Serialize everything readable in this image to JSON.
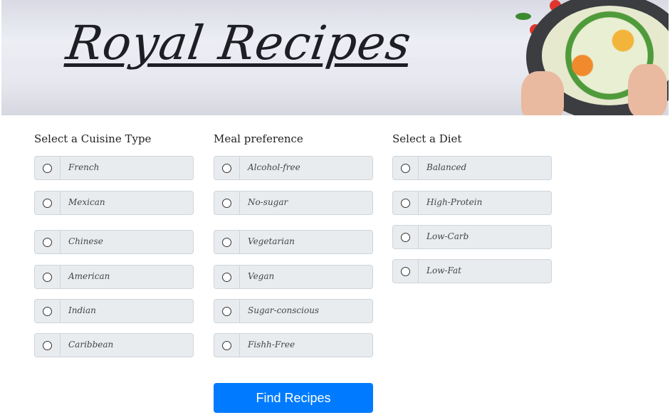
{
  "header": {
    "title": "Royal Recipes"
  },
  "cuisine": {
    "heading": "Select a Cuisine Type",
    "options": [
      "French",
      "Mexican",
      "Chinese",
      "American",
      "Indian",
      "Caribbean"
    ]
  },
  "meal": {
    "heading": "Meal preference",
    "options": [
      "Alcohol-free",
      "No-sugar",
      "Vegetarian",
      "Vegan",
      "Sugar-conscious",
      "Fishh-Free"
    ]
  },
  "diet": {
    "heading": "Select a Diet",
    "options": [
      "Balanced",
      "High-Protein",
      "Low-Carb",
      "Low-Fat"
    ]
  },
  "submit": {
    "label": "Find Recipes"
  },
  "colors": {
    "accent": "#007bff"
  }
}
